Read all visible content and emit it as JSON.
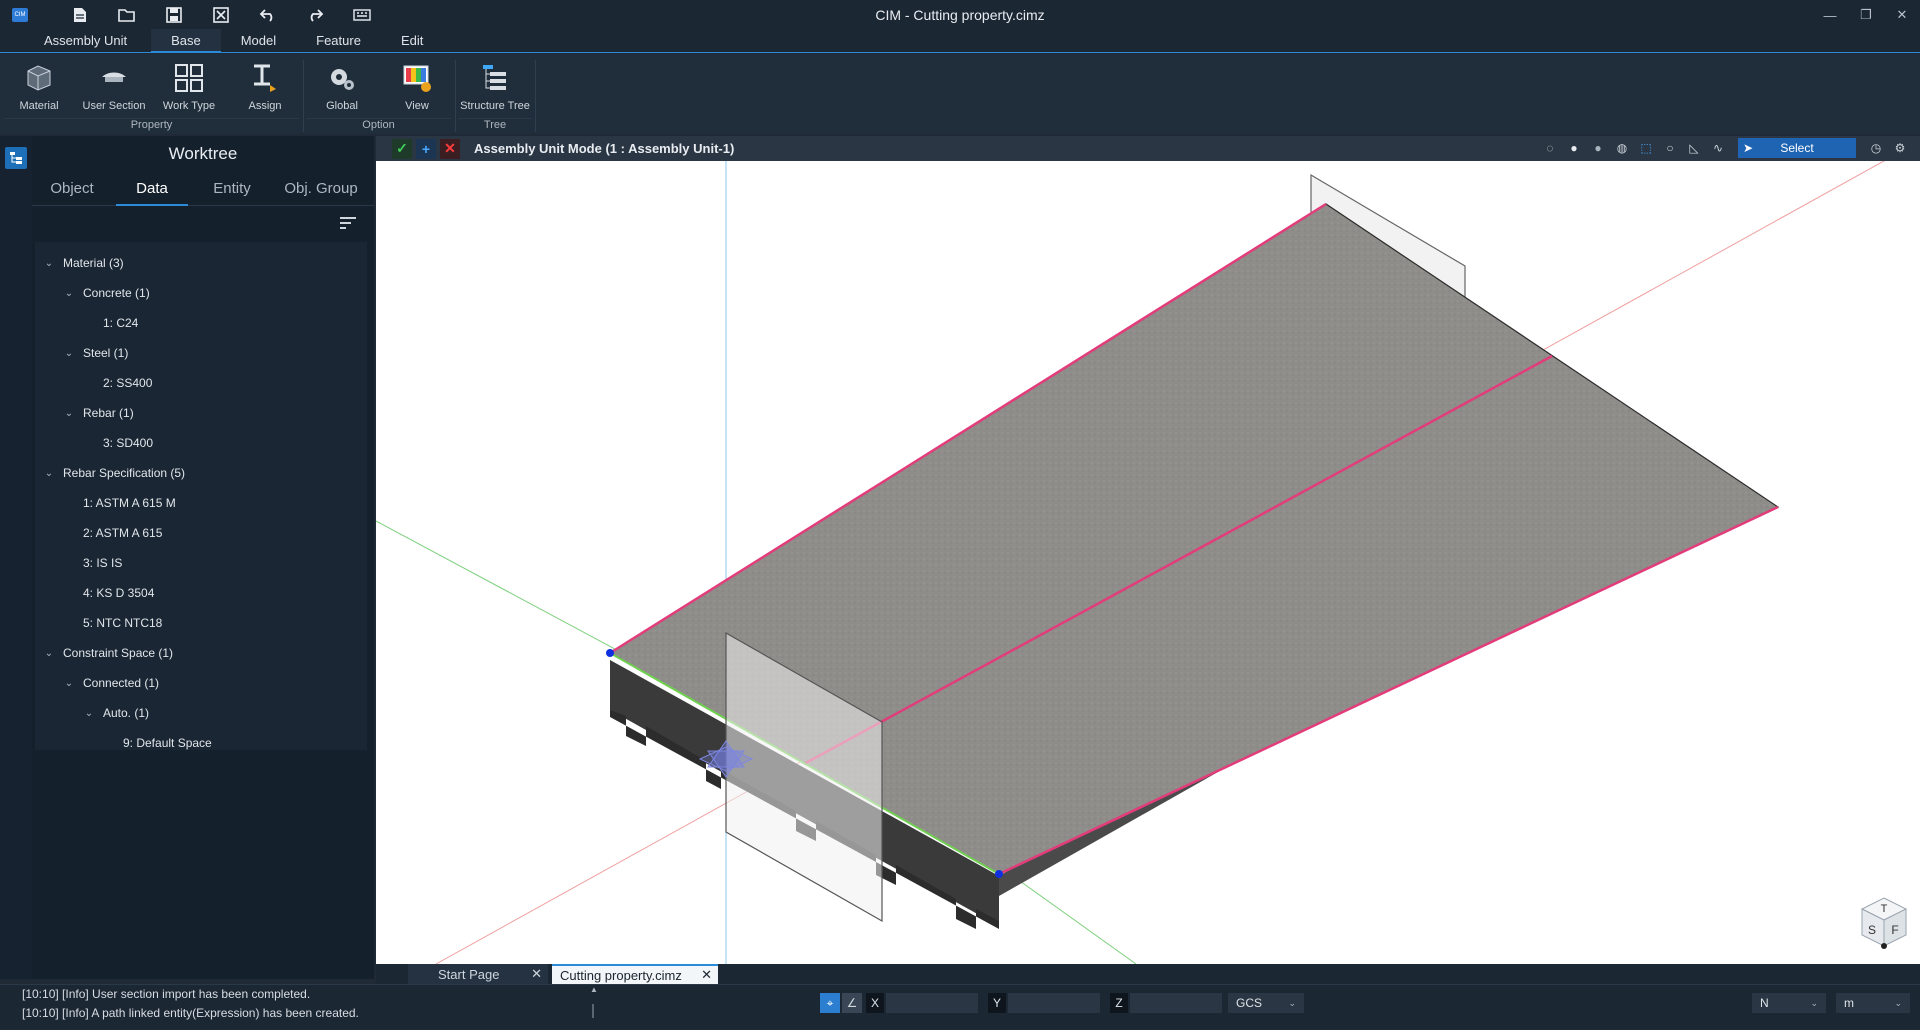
{
  "window": {
    "title": "CIM - Cutting property.cimz",
    "logo_text": "CIM"
  },
  "quick_access": {
    "icons": [
      "new-file-icon",
      "open-folder-icon",
      "save-icon",
      "close-file-icon",
      "undo-icon",
      "redo-icon",
      "keyboard-icon"
    ]
  },
  "ribbon_tabs": [
    {
      "label": "Assembly Unit"
    },
    {
      "label": "Base",
      "active": true
    },
    {
      "label": "Model"
    },
    {
      "label": "Feature"
    },
    {
      "label": "Edit"
    }
  ],
  "ribbon": {
    "buttons": [
      {
        "label": "Material"
      },
      {
        "label": "User Section"
      },
      {
        "label": "Work Type"
      },
      {
        "label": "Assign"
      },
      {
        "label": "Global"
      },
      {
        "label": "View"
      },
      {
        "label": "Structure Tree"
      }
    ],
    "groups": [
      {
        "label": "Property"
      },
      {
        "label": "Option"
      },
      {
        "label": "Tree"
      }
    ]
  },
  "worktree": {
    "title": "Worktree",
    "tabs": [
      {
        "label": "Object"
      },
      {
        "label": "Data",
        "active": true
      },
      {
        "label": "Entity"
      },
      {
        "label": "Obj. Group"
      }
    ],
    "nodes": [
      {
        "label": "Material (3)",
        "level": "lv0",
        "expanded": true
      },
      {
        "label": "Concrete (1)",
        "level": "lv1",
        "expanded": true
      },
      {
        "label": "1: C24",
        "level": "lv2leaf"
      },
      {
        "label": "Steel (1)",
        "level": "lv1",
        "expanded": true
      },
      {
        "label": "2: SS400",
        "level": "lv2leaf"
      },
      {
        "label": "Rebar (1)",
        "level": "lv1",
        "expanded": true
      },
      {
        "label": "3: SD400",
        "level": "lv2leaf"
      },
      {
        "label": "Rebar Specification (5)",
        "level": "lv0",
        "expanded": true
      },
      {
        "label": "1: ASTM A 615 M",
        "level": "lv1leaf"
      },
      {
        "label": "2: ASTM A 615",
        "level": "lv1leaf"
      },
      {
        "label": "3: IS IS",
        "level": "lv1leaf"
      },
      {
        "label": "4: KS D 3504",
        "level": "lv1leaf"
      },
      {
        "label": "5: NTC NTC18",
        "level": "lv1leaf"
      },
      {
        "label": "Constraint Space (1)",
        "level": "lv0",
        "expanded": true
      },
      {
        "label": "Connected (1)",
        "level": "lv1",
        "expanded": true
      },
      {
        "label": "Auto. (1)",
        "level": "lv2",
        "expanded": true
      },
      {
        "label": "9: Default Space",
        "level": "lv3leaf"
      }
    ]
  },
  "viewport": {
    "mode_label": "Assembly Unit Mode (1 : Assembly Unit-1)",
    "select_label": "Select",
    "view_cube": {
      "top": "T",
      "left": "S",
      "right": "F"
    }
  },
  "doc_tabs": [
    {
      "label": "Start Page"
    },
    {
      "label": "Cutting property.cimz",
      "active": true
    }
  ],
  "log": [
    "[10:10] [Info] User section import has been completed.",
    "[10:10] [Info] A path linked entity(Expression) has been created."
  ],
  "coords": {
    "x_label": "X",
    "y_label": "Y",
    "z_label": "Z",
    "x": "",
    "y": "",
    "z": "",
    "system": "GCS",
    "force_unit": "N",
    "length_unit": "m"
  }
}
